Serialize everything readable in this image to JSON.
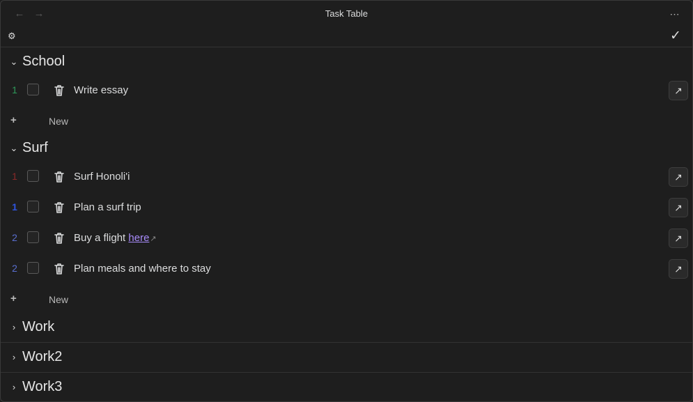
{
  "window": {
    "title": "Task Table"
  },
  "icons": {
    "back": "arrow-left-icon",
    "forward": "arrow-right-icon",
    "more": "more-horizontal-icon",
    "settings": "gear-icon",
    "confirm": "check-icon",
    "expanded": "chevron-down-icon",
    "collapsed": "chevron-right-icon",
    "delete": "trash-icon",
    "open": "arrow-up-right-icon",
    "add": "plus-icon"
  },
  "colors": {
    "background": "#1e1e1e",
    "link": "#a88bfa",
    "priority_green": "#2e9a5a",
    "priority_red": "#8b2a2a",
    "priority_blue_bold": "#2f55e0",
    "priority_blue": "#5a6fd0"
  },
  "groups": [
    {
      "name": "School",
      "expanded": true,
      "new_label": "New",
      "tasks": [
        {
          "priority": "1",
          "priority_color": "#2e9a5a",
          "text": "Write essay",
          "checked": false
        }
      ]
    },
    {
      "name": "Surf",
      "expanded": true,
      "new_label": "New",
      "tasks": [
        {
          "priority": "1",
          "priority_color": "#8b2a2a",
          "text": "Surf Honoli'i",
          "checked": false
        },
        {
          "priority": "1",
          "priority_color": "#2f55e0",
          "text": "Plan a surf trip",
          "checked": false
        },
        {
          "priority": "2",
          "priority_color": "#5a6fd0",
          "text": "Buy a flight ",
          "link_text": "here",
          "checked": false
        },
        {
          "priority": "2",
          "priority_color": "#5a6fd0",
          "text": "Plan meals and where to stay",
          "checked": false
        }
      ]
    },
    {
      "name": "Work",
      "expanded": false
    },
    {
      "name": "Work2",
      "expanded": false
    },
    {
      "name": "Work3",
      "expanded": false
    }
  ]
}
